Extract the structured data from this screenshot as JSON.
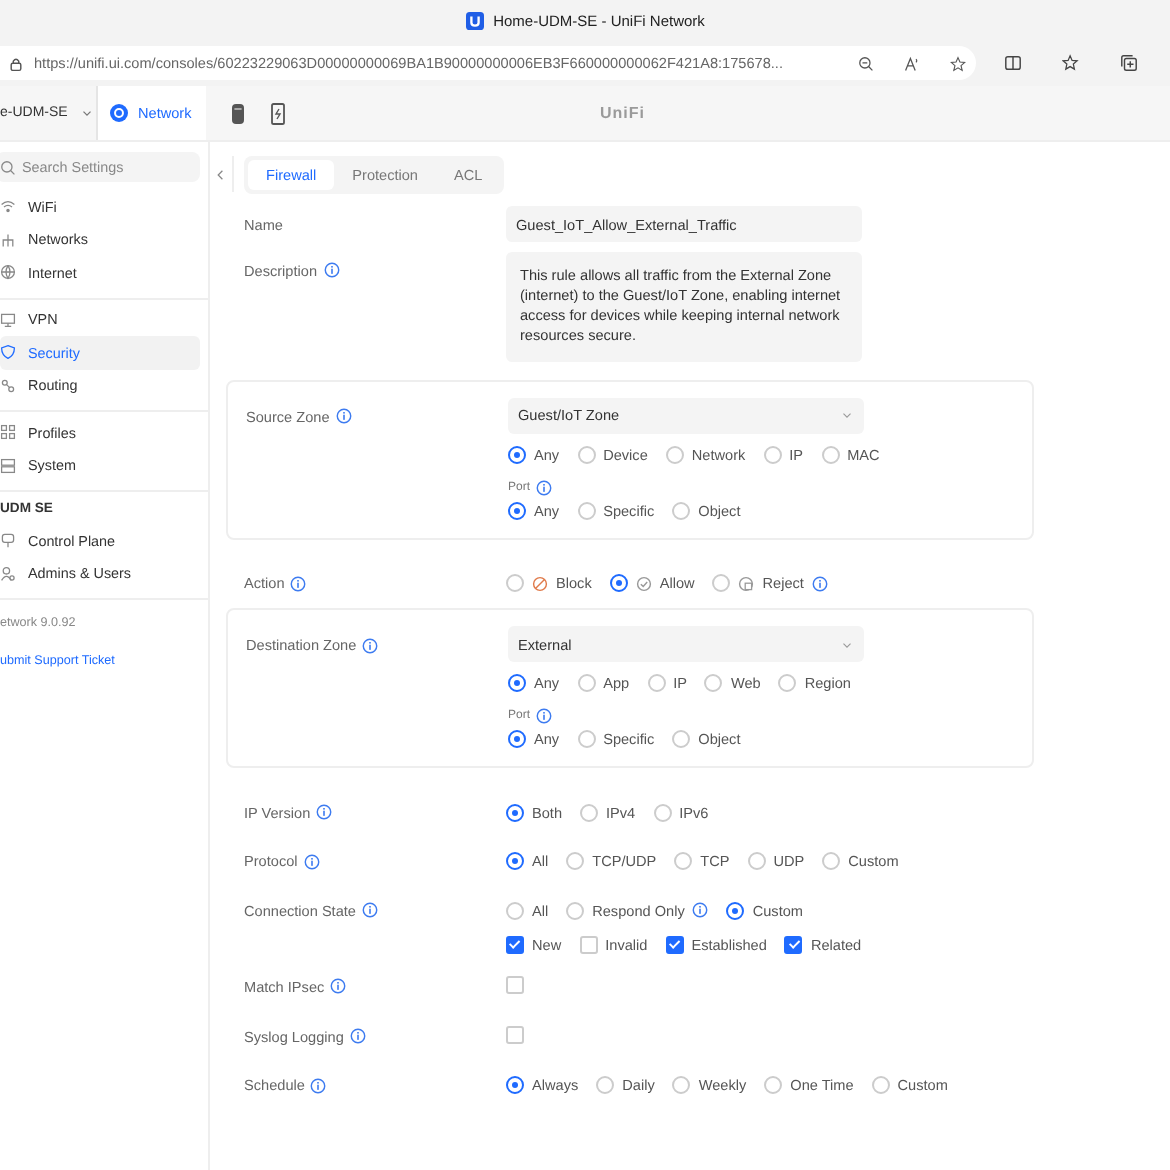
{
  "browser": {
    "tab_title": "Home-UDM-SE - UniFi Network",
    "url": "https://unifi.ui.com/consoles/60223229063D00000000069BA1B90000000006EB3F660000000062F421A8:175678..."
  },
  "header": {
    "console": "e-UDM-SE",
    "app": "Network",
    "logo": "UniFi"
  },
  "sidebar": {
    "search": {
      "placeholder": "Search Settings"
    },
    "groups": [
      {
        "items": [
          {
            "label": "WiFi",
            "selected": false
          },
          {
            "label": "Networks",
            "selected": false
          },
          {
            "label": "Internet",
            "selected": false
          }
        ]
      },
      {
        "items": [
          {
            "label": "VPN",
            "selected": false
          },
          {
            "label": "Security",
            "selected": true
          },
          {
            "label": "Routing",
            "selected": false
          }
        ]
      },
      {
        "items": [
          {
            "label": "Profiles",
            "selected": false
          },
          {
            "label": "System",
            "selected": false
          }
        ]
      },
      {
        "title": "UDM SE",
        "items": [
          {
            "label": "Control Plane",
            "selected": false
          },
          {
            "label": "Admins & Users",
            "selected": false
          }
        ]
      }
    ],
    "version": "etwork 9.0.92",
    "link": "ubmit Support Ticket"
  },
  "tabs": [
    {
      "label": "Firewall",
      "selected": true
    },
    {
      "label": "Protection",
      "selected": false
    },
    {
      "label": "ACL",
      "selected": false
    }
  ],
  "rows": [
    {
      "kind": "input",
      "label": "Name",
      "value": "Guest_IoT_Allow_External_Traffic"
    },
    {
      "kind": "textarea",
      "label": "Description",
      "info": true,
      "value": "This rule allows all traffic from the External Zone (internet) to the Guest/IoT Zone, enabling internet access for devices while keeping internal network resources secure."
    },
    {
      "kind": "zone",
      "label": "Source Zone",
      "info": true,
      "value": "Guest/IoT Zone",
      "options": [
        {
          "label": "Any",
          "selected": true
        },
        {
          "label": "Device",
          "selected": false
        },
        {
          "label": "Network",
          "selected": false
        },
        {
          "label": "IP",
          "selected": false
        },
        {
          "label": "MAC",
          "selected": false
        }
      ],
      "port_label": "Port",
      "port_options": [
        {
          "label": "Any",
          "selected": true
        },
        {
          "label": "Specific",
          "selected": false
        },
        {
          "label": "Object",
          "selected": false
        }
      ]
    },
    {
      "kind": "action",
      "label": "Action",
      "info": true,
      "options": [
        {
          "label": "Block",
          "selected": false
        },
        {
          "label": "Allow",
          "selected": true
        },
        {
          "label": "Reject",
          "selected": false,
          "info": true
        }
      ]
    },
    {
      "kind": "zone",
      "label": "Destination Zone",
      "info": true,
      "value": "External",
      "options": [
        {
          "label": "Any",
          "selected": true
        },
        {
          "label": "App",
          "selected": false
        },
        {
          "label": "IP",
          "selected": false
        },
        {
          "label": "Web",
          "selected": false
        },
        {
          "label": "Region",
          "selected": false
        }
      ],
      "port_label": "Port",
      "port_options": [
        {
          "label": "Any",
          "selected": true
        },
        {
          "label": "Specific",
          "selected": false
        },
        {
          "label": "Object",
          "selected": false
        }
      ]
    },
    {
      "kind": "radio",
      "label": "IP Version",
      "info": true,
      "options": [
        {
          "label": "Both",
          "selected": true
        },
        {
          "label": "IPv4",
          "selected": false
        },
        {
          "label": "IPv6",
          "selected": false
        }
      ]
    },
    {
      "kind": "radio",
      "label": "Protocol",
      "info": true,
      "options": [
        {
          "label": "All",
          "selected": true
        },
        {
          "label": "TCP/UDP",
          "selected": false
        },
        {
          "label": "TCP",
          "selected": false
        },
        {
          "label": "UDP",
          "selected": false
        },
        {
          "label": "Custom",
          "selected": false
        }
      ]
    },
    {
      "kind": "radio",
      "label": "Connection State",
      "info": true,
      "options": [
        {
          "label": "All",
          "selected": false
        },
        {
          "label": "Respond Only",
          "selected": false,
          "info": true
        },
        {
          "label": "Custom",
          "selected": true
        }
      ]
    },
    {
      "kind": "checks",
      "options": [
        {
          "label": "New",
          "checked": true
        },
        {
          "label": "Invalid",
          "checked": false
        },
        {
          "label": "Established",
          "checked": true
        },
        {
          "label": "Related",
          "checked": true
        }
      ]
    },
    {
      "kind": "checkbox",
      "label": "Match IPsec",
      "info": true,
      "checked": false
    },
    {
      "kind": "checkbox",
      "label": "Syslog Logging",
      "info": true,
      "checked": false
    },
    {
      "kind": "radio",
      "label": "Schedule",
      "info": true,
      "options": [
        {
          "label": "Always",
          "selected": true
        },
        {
          "label": "Daily",
          "selected": false
        },
        {
          "label": "Weekly",
          "selected": false
        },
        {
          "label": "One Time",
          "selected": false
        },
        {
          "label": "Custom",
          "selected": false
        }
      ]
    }
  ]
}
